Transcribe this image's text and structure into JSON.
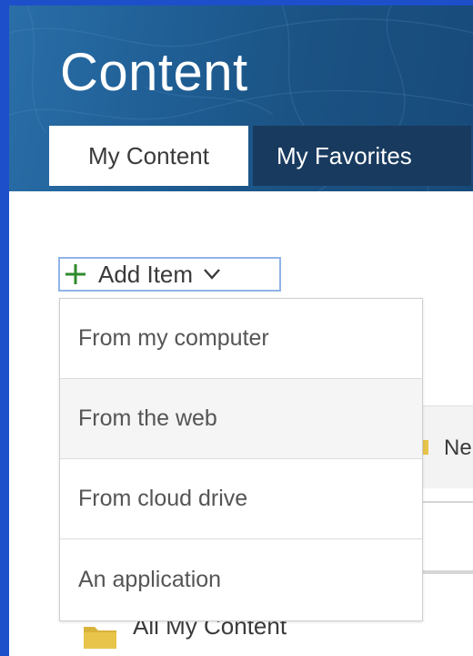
{
  "header": {
    "title": "Content"
  },
  "tabs": [
    {
      "label": "My Content",
      "active": true
    },
    {
      "label": "My Favorites",
      "active": false
    }
  ],
  "add_item": {
    "label": "Add Item",
    "icon": "plus-icon",
    "chevron": "chevron-down-icon"
  },
  "dropdown": {
    "items": [
      {
        "label": "From my computer"
      },
      {
        "label": "From the web",
        "highlighted": true
      },
      {
        "label": "From cloud drive"
      },
      {
        "label": "An application"
      }
    ]
  },
  "background": {
    "new_label_partial": "Ne",
    "folder_label": "All My Content"
  },
  "colors": {
    "frame_blue": "#1d4fca",
    "header_blue": "#1f5e94",
    "inactive_tab": "#183a5e",
    "plus_green": "#2e8b2e",
    "focus_border": "#8fb4e8",
    "folder_yellow": "#e8c44a"
  }
}
